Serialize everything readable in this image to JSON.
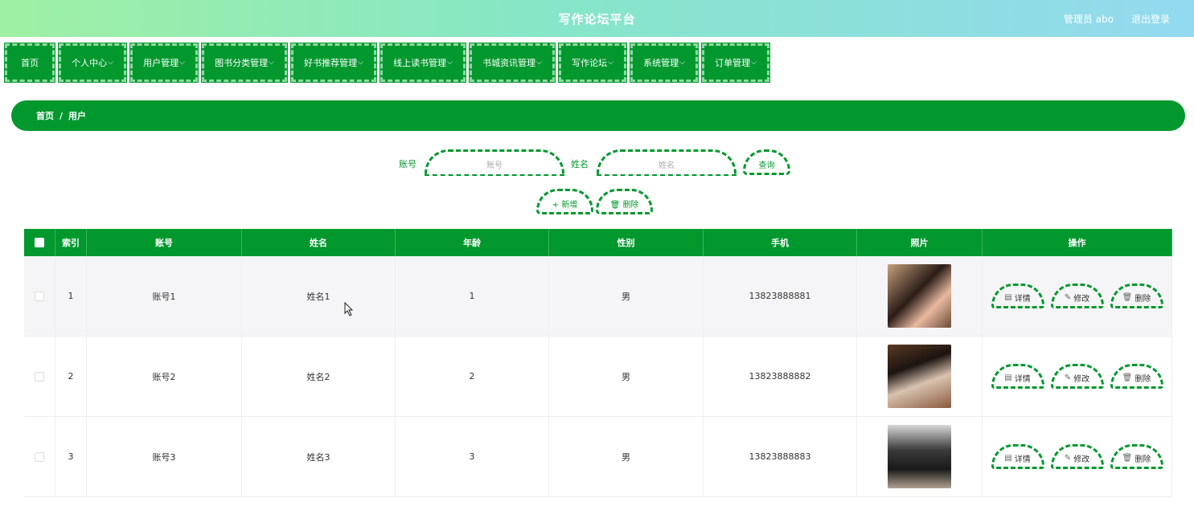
{
  "header": {
    "title": "写作论坛平台",
    "user": "管理员 abo",
    "logout": "退出登录"
  },
  "nav": [
    {
      "label": "首页",
      "chevron": false
    },
    {
      "label": "个人中心",
      "chevron": true
    },
    {
      "label": "用户管理",
      "chevron": true
    },
    {
      "label": "图书分类管理",
      "chevron": true
    },
    {
      "label": "好书推荐管理",
      "chevron": true
    },
    {
      "label": "线上读书管理",
      "chevron": true
    },
    {
      "label": "书城资讯管理",
      "chevron": true
    },
    {
      "label": "写作论坛",
      "chevron": true
    },
    {
      "label": "系统管理",
      "chevron": true
    },
    {
      "label": "订单管理",
      "chevron": true
    }
  ],
  "breadcrumb": {
    "home": "首页",
    "separator": "/",
    "current": "用户"
  },
  "search": {
    "account_label": "账号",
    "account_placeholder": "账号",
    "name_label": "姓名",
    "name_placeholder": "姓名",
    "query_button": "查询",
    "add_button": "新增",
    "delete_button": "删除"
  },
  "table": {
    "headers": [
      "索引",
      "账号",
      "姓名",
      "年龄",
      "性别",
      "手机",
      "照片",
      "操作"
    ],
    "rows": [
      {
        "index": "1",
        "account": "账号1",
        "name": "姓名1",
        "age": "1",
        "gender": "男",
        "phone": "13823888881"
      },
      {
        "index": "2",
        "account": "账号2",
        "name": "姓名2",
        "age": "2",
        "gender": "男",
        "phone": "13823888882"
      },
      {
        "index": "3",
        "account": "账号3",
        "name": "姓名3",
        "age": "3",
        "gender": "男",
        "phone": "13823888883"
      }
    ],
    "actions": {
      "detail": "详情",
      "edit": "修改",
      "delete": "删除"
    }
  },
  "colors": {
    "primary": "#02982e",
    "header_gradient_start": "#9ff0a4",
    "header_gradient_end": "#93d9f0"
  }
}
